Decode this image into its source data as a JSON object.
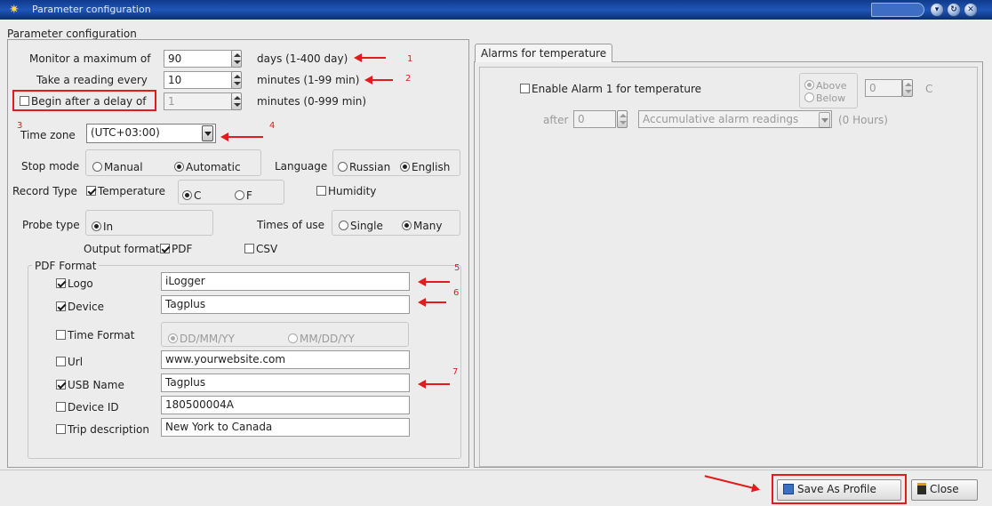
{
  "window": {
    "title": "Parameter configuration"
  },
  "panel_title": "Parameter configuration",
  "monitor": {
    "label": "Monitor a maximum of",
    "value": "90",
    "unit": "days (1-400 day)"
  },
  "reading": {
    "label": "Take a reading every",
    "value": "10",
    "unit": "minutes (1-99 min)"
  },
  "delay": {
    "label": "Begin after a delay of",
    "value": "1",
    "unit": "minutes (0-999 min)",
    "checked": false
  },
  "timezone": {
    "label": "Time zone",
    "value": "(UTC+03:00)"
  },
  "stop_mode": {
    "label": "Stop mode",
    "options": [
      "Manual",
      "Automatic"
    ],
    "selected": "Automatic"
  },
  "language": {
    "label": "Language",
    "options": [
      "Russian",
      "English"
    ],
    "selected": "English"
  },
  "record_type": {
    "label": "Record Type",
    "temperature": "Temperature",
    "temp_checked": true,
    "units": [
      "C",
      "F"
    ],
    "unit_selected": "C",
    "humidity": "Humidity",
    "humidity_checked": false
  },
  "probe_type": {
    "label": "Probe type",
    "option": "In"
  },
  "times_of_use": {
    "label": "Times of use",
    "options": [
      "Single",
      "Many"
    ],
    "selected": "Many"
  },
  "output_format": {
    "label": "Output format",
    "pdf": "PDF",
    "pdf_checked": true,
    "csv": "CSV",
    "csv_checked": false
  },
  "pdf_format": {
    "legend": "PDF Format",
    "logo": {
      "label": "Logo",
      "checked": true,
      "value": "iLogger"
    },
    "device": {
      "label": "Device",
      "checked": true,
      "value": "Tagplus"
    },
    "time_format": {
      "label": "Time Format",
      "checked": false,
      "options": [
        "DD/MM/YY",
        "MM/DD/YY"
      ],
      "selected": "DD/MM/YY"
    },
    "url": {
      "label": "Url",
      "checked": false,
      "value": "www.yourwebsite.com"
    },
    "usb_name": {
      "label": "USB Name",
      "checked": true,
      "value": "Tagplus"
    },
    "device_id": {
      "label": "Device ID",
      "checked": false,
      "value": "180500004A"
    },
    "trip": {
      "label": "Trip description",
      "checked": false,
      "value": "New York to Canada"
    }
  },
  "alarms": {
    "tab": "Alarms for temperature",
    "enable_label": "Enable Alarm 1 for temperature",
    "enable_checked": false,
    "above": "Above",
    "below": "Below",
    "threshold": "0",
    "unit": "C",
    "after_label": "after",
    "after_value": "0",
    "mode": "Accumulative alarm readings",
    "hours": "(0 Hours)"
  },
  "annotations": [
    "1",
    "2",
    "3",
    "4",
    "5",
    "6",
    "7"
  ],
  "buttons": {
    "save_profile": "Save As Profile",
    "close": "Close"
  },
  "colors": {
    "titlebar": "#1f56b8",
    "annotation": "#e21c1c",
    "panel": "#ececec"
  }
}
